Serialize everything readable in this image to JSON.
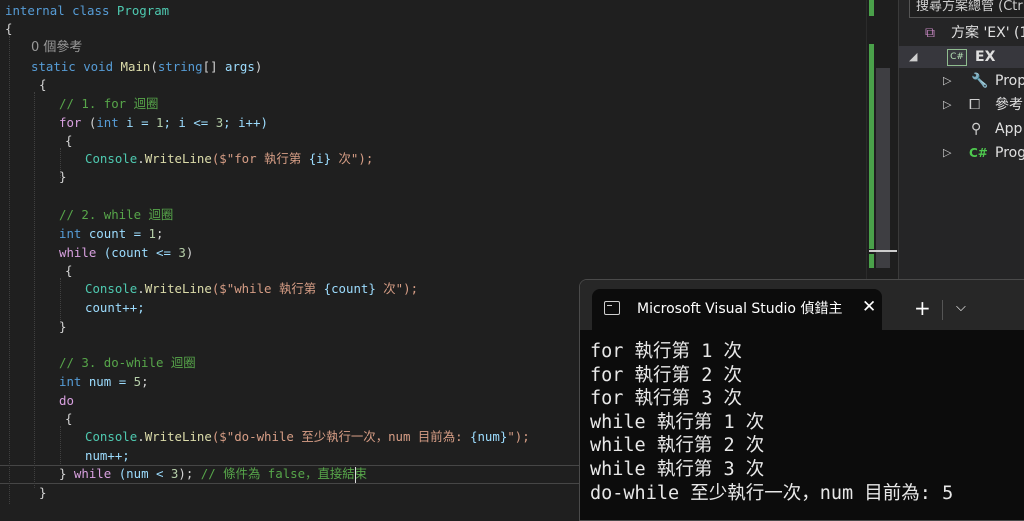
{
  "editor": {
    "lines": [
      {
        "parts": [
          {
            "t": "internal class ",
            "c": "kw"
          },
          {
            "t": "Program",
            "c": "typ"
          }
        ]
      },
      {
        "parts": [
          {
            "t": "{",
            "c": "p"
          }
        ]
      },
      {
        "parts": [
          {
            "t": "0 個參考",
            "c": "lens"
          }
        ]
      },
      {
        "parts": [
          {
            "t": "static void ",
            "c": "kw"
          },
          {
            "t": "Main",
            "c": "mth"
          },
          {
            "t": "(",
            "c": "p"
          },
          {
            "t": "string",
            "c": "kw"
          },
          {
            "t": "[] ",
            "c": "p"
          },
          {
            "t": "args",
            "c": "par"
          },
          {
            "t": ")",
            "c": "p"
          }
        ]
      },
      {
        "parts": [
          {
            "t": "{",
            "c": "p"
          }
        ]
      },
      {
        "parts": [
          {
            "t": "// 1. for 迴圈",
            "c": "cmt"
          }
        ]
      },
      {
        "parts": [
          {
            "t": "for",
            "c": "ctl"
          },
          {
            "t": " (",
            "c": "p"
          },
          {
            "t": "int",
            "c": "kw"
          },
          {
            "t": " i = ",
            "c": "par"
          },
          {
            "t": "1",
            "c": "num"
          },
          {
            "t": "; i <= ",
            "c": "par"
          },
          {
            "t": "3",
            "c": "num"
          },
          {
            "t": "; i++)",
            "c": "par"
          }
        ]
      },
      {
        "parts": [
          {
            "t": "{",
            "c": "p"
          }
        ]
      },
      {
        "parts": [
          {
            "t": "Console",
            "c": "typ"
          },
          {
            "t": ".",
            "c": "p"
          },
          {
            "t": "WriteLine",
            "c": "mth"
          },
          {
            "t": "($\"for 執行第 ",
            "c": "str"
          },
          {
            "t": "{i}",
            "c": "par"
          },
          {
            "t": " 次\");",
            "c": "str"
          }
        ]
      },
      {
        "parts": [
          {
            "t": "}",
            "c": "p"
          }
        ]
      },
      {
        "parts": []
      },
      {
        "parts": [
          {
            "t": "// 2. while 迴圈",
            "c": "cmt"
          }
        ]
      },
      {
        "parts": [
          {
            "t": "int",
            "c": "kw"
          },
          {
            "t": " count = ",
            "c": "par"
          },
          {
            "t": "1",
            "c": "num"
          },
          {
            "t": ";",
            "c": "p"
          }
        ]
      },
      {
        "parts": [
          {
            "t": "while",
            "c": "ctl"
          },
          {
            "t": " (count <= ",
            "c": "par"
          },
          {
            "t": "3",
            "c": "num"
          },
          {
            "t": ")",
            "c": "p"
          }
        ]
      },
      {
        "parts": [
          {
            "t": "{",
            "c": "p"
          }
        ]
      },
      {
        "parts": [
          {
            "t": "Console",
            "c": "typ"
          },
          {
            "t": ".",
            "c": "p"
          },
          {
            "t": "WriteLine",
            "c": "mth"
          },
          {
            "t": "($\"while 執行第 ",
            "c": "str"
          },
          {
            "t": "{count}",
            "c": "par"
          },
          {
            "t": " 次\");",
            "c": "str"
          }
        ]
      },
      {
        "parts": [
          {
            "t": "count++;",
            "c": "par"
          }
        ]
      },
      {
        "parts": [
          {
            "t": "}",
            "c": "p"
          }
        ]
      },
      {
        "parts": []
      },
      {
        "parts": [
          {
            "t": "// 3. do-while 迴圈",
            "c": "cmt"
          }
        ]
      },
      {
        "parts": [
          {
            "t": "int",
            "c": "kw"
          },
          {
            "t": " num = ",
            "c": "par"
          },
          {
            "t": "5",
            "c": "num"
          },
          {
            "t": ";",
            "c": "p"
          }
        ]
      },
      {
        "parts": [
          {
            "t": "do",
            "c": "ctl"
          }
        ]
      },
      {
        "parts": [
          {
            "t": "{",
            "c": "p"
          }
        ]
      },
      {
        "parts": [
          {
            "t": "Console",
            "c": "typ"
          },
          {
            "t": ".",
            "c": "p"
          },
          {
            "t": "WriteLine",
            "c": "mth"
          },
          {
            "t": "($\"do-while 至少執行一次，num 目前為: ",
            "c": "str"
          },
          {
            "t": "{num}",
            "c": "par"
          },
          {
            "t": "\");",
            "c": "str"
          }
        ]
      },
      {
        "parts": [
          {
            "t": "num++;",
            "c": "par"
          }
        ]
      },
      {
        "parts": [
          {
            "t": "} ",
            "c": "p"
          },
          {
            "t": "while",
            "c": "ctl"
          },
          {
            "t": " (num < ",
            "c": "par"
          },
          {
            "t": "3",
            "c": "num"
          },
          {
            "t": "); ",
            "c": "p"
          },
          {
            "t": "// 條件為 false，直接結束",
            "c": "cmt"
          }
        ]
      },
      {
        "parts": [
          {
            "t": "}",
            "c": "p"
          }
        ]
      }
    ]
  },
  "solution_explorer": {
    "search_placeholder": "搜尋方案總管 (Ctrl+;)",
    "solution_label": "方案 'EX' (1",
    "project_label": "EX",
    "items": [
      {
        "label": "Prop",
        "icon": "wrench-icon"
      },
      {
        "label": "參考",
        "icon": "references-icon"
      },
      {
        "label": "App",
        "icon": "config-icon"
      },
      {
        "label": "Prog",
        "icon": "csharp-file-icon"
      }
    ]
  },
  "terminal": {
    "tab_title": "Microsoft Visual Studio 偵錯主",
    "output": [
      "for 執行第 1 次",
      "for 執行第 2 次",
      "for 執行第 3 次",
      "while 執行第 1 次",
      "while 執行第 2 次",
      "while 執行第 3 次",
      "do-while 至少執行一次，num 目前為: 5"
    ]
  }
}
